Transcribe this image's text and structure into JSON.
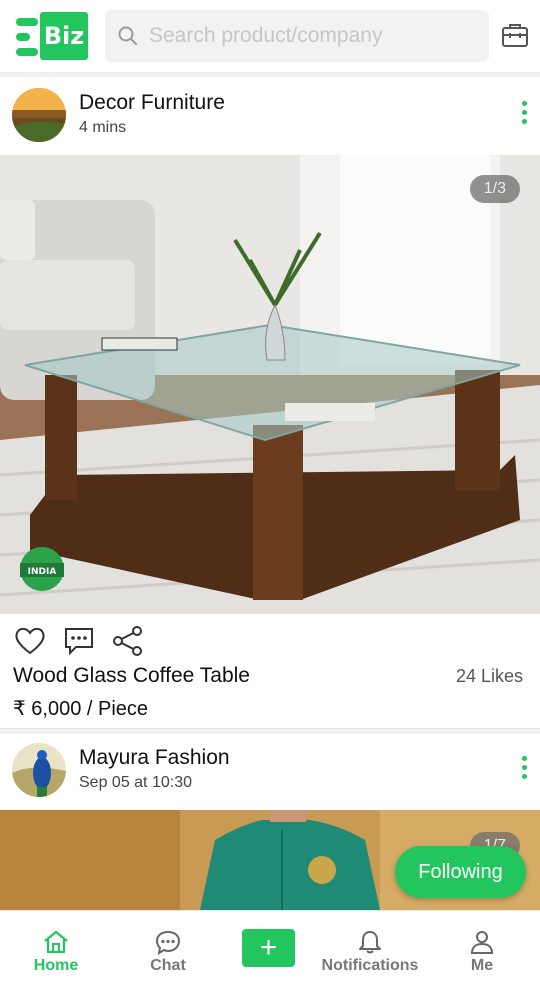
{
  "header": {
    "logo_text": "Biz",
    "search_placeholder": "Search product/company",
    "briefcase_icon": "briefcase-icon"
  },
  "posts": [
    {
      "author": "Decor Furniture",
      "time": "4 mins",
      "image_counter": "1/3",
      "badge_text": "MADE IN INDIA",
      "title": "Wood Glass Coffee Table",
      "likes": "24 Likes",
      "price": "₹ 6,000 / Piece",
      "actions": [
        "heart-icon",
        "comment-icon",
        "share-icon"
      ]
    },
    {
      "author": "Mayura Fashion",
      "time": "Sep 05 at 10:30",
      "image_counter": "1/7",
      "follow_label": "Following"
    }
  ],
  "bottom_nav": {
    "items": [
      {
        "label": "Home",
        "icon": "home-icon",
        "active": true
      },
      {
        "label": "Chat",
        "icon": "chat-icon",
        "active": false
      },
      {
        "label": "",
        "icon": "plus-icon",
        "active": false
      },
      {
        "label": "Notifications",
        "icon": "bell-icon",
        "active": false
      },
      {
        "label": "Me",
        "icon": "person-icon",
        "active": false
      }
    ]
  },
  "colors": {
    "accent": "#22c55e",
    "text_primary": "#111111",
    "text_secondary": "#555555",
    "divider": "#f1f1f1"
  }
}
